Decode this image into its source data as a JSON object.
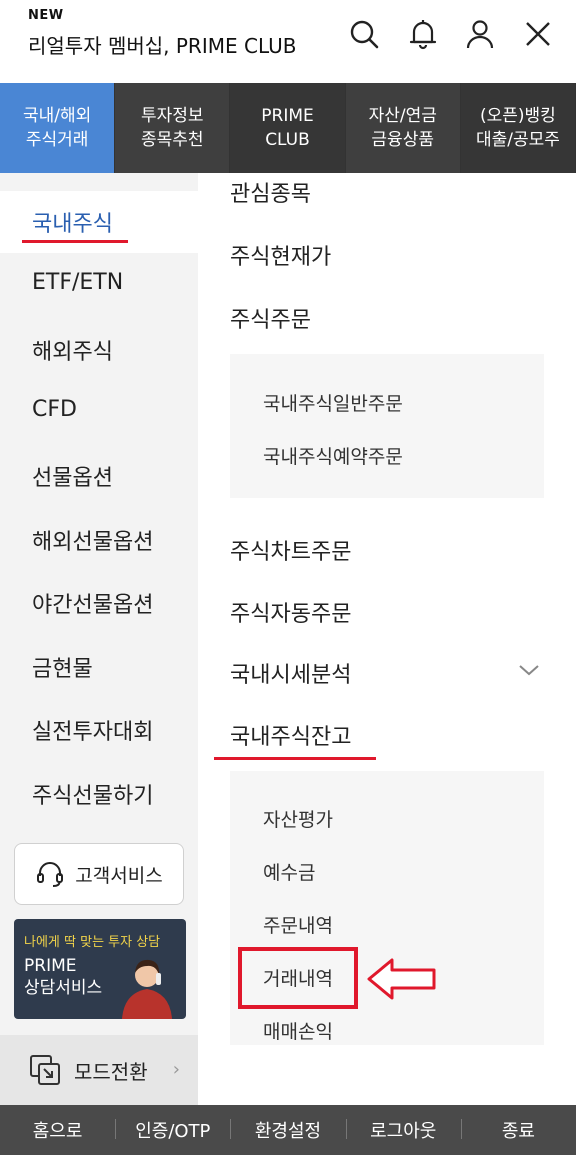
{
  "header": {
    "badge": "NEW",
    "brand": "리얼투자 멤버십, PRIME CLUB",
    "icons": [
      "search-icon",
      "bell-icon",
      "user-icon",
      "close-icon"
    ]
  },
  "topnav": {
    "tabs": [
      {
        "label": "국내/해외\n주식거래",
        "active": true
      },
      {
        "label": "투자정보\n종목추천",
        "active": false
      },
      {
        "label": "PRIME\nCLUB",
        "active": false
      },
      {
        "label": "자산/연금\n금융상품",
        "active": false
      },
      {
        "label": "(오픈)뱅킹\n대출/공모주",
        "active": false
      }
    ]
  },
  "sidebar": {
    "items": [
      {
        "label": "국내주식",
        "active": true
      },
      {
        "label": "ETF/ETN"
      },
      {
        "label": "해외주식"
      },
      {
        "label": "CFD"
      },
      {
        "label": "선물옵션"
      },
      {
        "label": "해외선물옵션"
      },
      {
        "label": "야간선물옵션"
      },
      {
        "label": "금현물"
      },
      {
        "label": "실전투자대회"
      },
      {
        "label": "주식선물하기"
      }
    ],
    "customer_service": "고객서비스",
    "promo": {
      "line1": "나에게 딱 맞는 투자 상담",
      "line2": "PRIME",
      "line3": "상담서비스"
    },
    "mode_switch": "모드전환"
  },
  "content": {
    "items": {
      "watchlist": "관심종목",
      "current_price": "주식현재가",
      "order": "주식주문",
      "order_sub": [
        "국내주식일반주문",
        "국내주식예약주문"
      ],
      "chart_order": "주식차트주문",
      "auto_order": "주식자동주문",
      "market_analysis": "국내시세분석",
      "balance": "국내주식잔고",
      "balance_sub": [
        "자산평가",
        "예수금",
        "주문내역",
        "거래내역",
        "매매손익"
      ]
    },
    "highlight_color": "#e0182c"
  },
  "bottombar": {
    "items": [
      "홈으로",
      "인증/OTP",
      "환경설정",
      "로그아웃",
      "종료"
    ]
  }
}
